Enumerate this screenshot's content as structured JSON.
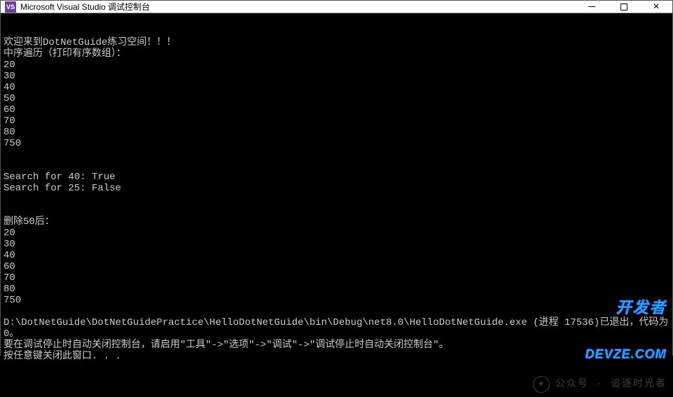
{
  "window": {
    "icon_text": "VS",
    "title": "Microsoft Visual Studio 调试控制台"
  },
  "console": {
    "lines": [
      "欢迎来到DotNetGuide练习空间！！！",
      "中序遍历（打印有序数组）：",
      "20",
      "30",
      "40",
      "50",
      "60",
      "70",
      "80",
      "750",
      "",
      "",
      "Search for 40: True",
      "Search for 25: False",
      "",
      "",
      "删除50后：",
      "20",
      "30",
      "40",
      "60",
      "70",
      "80",
      "750",
      "",
      "D:\\DotNetGuide\\DotNetGuidePractice\\HelloDotNetGuide\\bin\\Debug\\net8.0\\HelloDotNetGuide.exe (进程 17536)已退出，代码为 0。",
      "要在调试停止时自动关闭控制台，请启用\"工具\"->\"选项\"->\"调试\"->\"调试停止时自动关闭控制台\"。",
      "按任意键关闭此窗口. . ."
    ]
  },
  "watermark": {
    "label": "公众号 · 追逐时光者",
    "logo_line1": "开发者",
    "logo_line2": "DEVZE.COM"
  }
}
